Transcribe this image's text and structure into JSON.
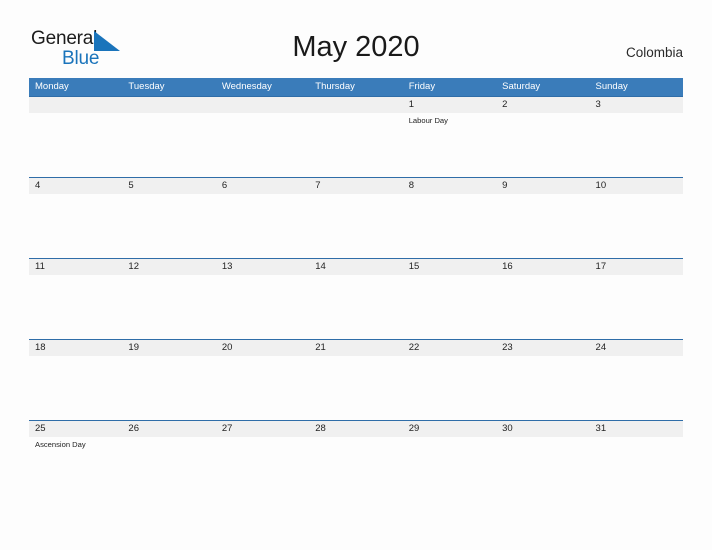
{
  "header": {
    "logo": {
      "text_primary": "General",
      "text_secondary": "Blue",
      "triangle_icon": "blue-triangle-icon",
      "accent_color": "#1a74bb"
    },
    "title": "May 2020",
    "country": "Colombia"
  },
  "theme": {
    "header_bar_color": "#3a7cba",
    "row_rule_color": "#2f6da8",
    "date_band_color": "#f0f0f0",
    "page_background": "#fdfdfd",
    "text_color": "#232323"
  },
  "calendar": {
    "month": "May",
    "year": "2020",
    "first_day_of_week": "Monday",
    "weekdays": [
      "Monday",
      "Tuesday",
      "Wednesday",
      "Thursday",
      "Friday",
      "Saturday",
      "Sunday"
    ],
    "weeks": [
      {
        "days": [
          {
            "number": "",
            "event": ""
          },
          {
            "number": "",
            "event": ""
          },
          {
            "number": "",
            "event": ""
          },
          {
            "number": "",
            "event": ""
          },
          {
            "number": "1",
            "event": "Labour Day"
          },
          {
            "number": "2",
            "event": ""
          },
          {
            "number": "3",
            "event": ""
          }
        ]
      },
      {
        "days": [
          {
            "number": "4",
            "event": ""
          },
          {
            "number": "5",
            "event": ""
          },
          {
            "number": "6",
            "event": ""
          },
          {
            "number": "7",
            "event": ""
          },
          {
            "number": "8",
            "event": ""
          },
          {
            "number": "9",
            "event": ""
          },
          {
            "number": "10",
            "event": ""
          }
        ]
      },
      {
        "days": [
          {
            "number": "11",
            "event": ""
          },
          {
            "number": "12",
            "event": ""
          },
          {
            "number": "13",
            "event": ""
          },
          {
            "number": "14",
            "event": ""
          },
          {
            "number": "15",
            "event": ""
          },
          {
            "number": "16",
            "event": ""
          },
          {
            "number": "17",
            "event": ""
          }
        ]
      },
      {
        "days": [
          {
            "number": "18",
            "event": ""
          },
          {
            "number": "19",
            "event": ""
          },
          {
            "number": "20",
            "event": ""
          },
          {
            "number": "21",
            "event": ""
          },
          {
            "number": "22",
            "event": ""
          },
          {
            "number": "23",
            "event": ""
          },
          {
            "number": "24",
            "event": ""
          }
        ]
      },
      {
        "days": [
          {
            "number": "25",
            "event": "Ascension Day"
          },
          {
            "number": "26",
            "event": ""
          },
          {
            "number": "27",
            "event": ""
          },
          {
            "number": "28",
            "event": ""
          },
          {
            "number": "29",
            "event": ""
          },
          {
            "number": "30",
            "event": ""
          },
          {
            "number": "31",
            "event": ""
          }
        ]
      }
    ],
    "holidays": [
      {
        "date": "1",
        "name": "Labour Day"
      },
      {
        "date": "25",
        "name": "Ascension Day"
      }
    ]
  }
}
